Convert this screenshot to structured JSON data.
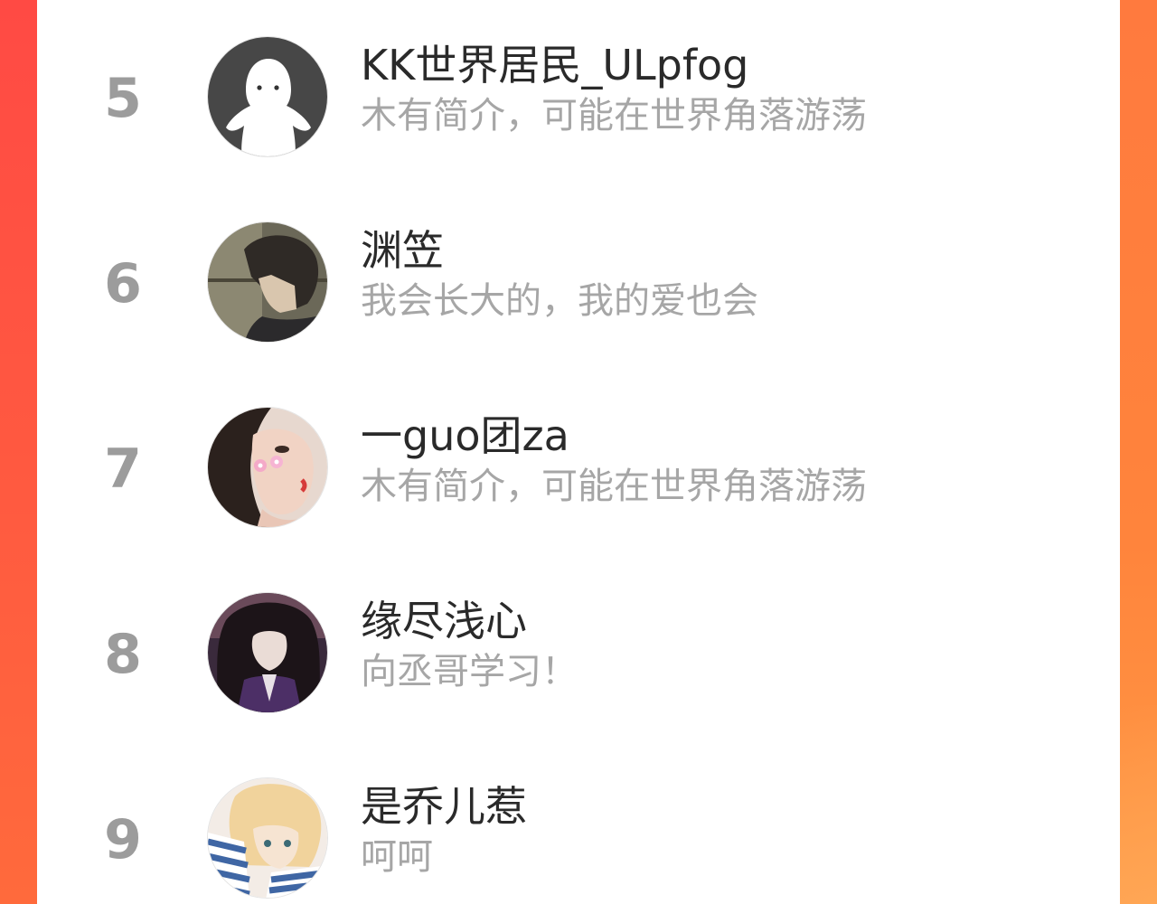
{
  "ranking": {
    "items": [
      {
        "rank": "5",
        "name": "KK世界居民_ULpfog",
        "bio": "木有简介，可能在世界角落游荡",
        "avatar": "default-ghost-avatar"
      },
      {
        "rank": "6",
        "name": "渊笠",
        "bio": "我会长大的，我的爱也会",
        "avatar": "anime-boy-avatar"
      },
      {
        "rank": "7",
        "name": "一guo团za",
        "bio": "木有简介，可能在世界角落游荡",
        "avatar": "girl-photo-avatar"
      },
      {
        "rank": "8",
        "name": "缘尽浅心",
        "bio": "向丞哥学习！",
        "avatar": "anime-dark-hair-avatar"
      },
      {
        "rank": "9",
        "name": "是乔儿惹",
        "bio": "呵呵",
        "avatar": "anime-blonde-avatar"
      }
    ]
  },
  "colors": {
    "background_left": "#ff4a44",
    "background_right": "#ff7a3e",
    "rank_text": "#9c9c9c",
    "name_text": "#2a2a2a",
    "bio_text": "#a6a6a6"
  }
}
